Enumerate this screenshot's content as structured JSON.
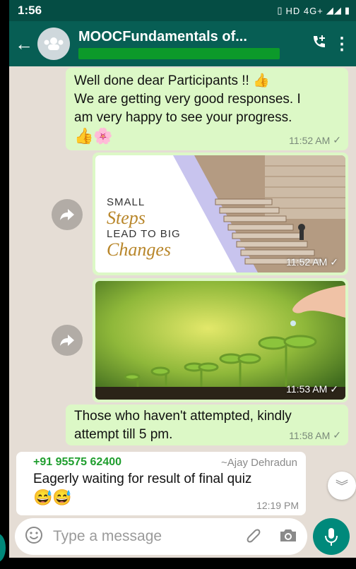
{
  "status_bar": {
    "time": "1:56",
    "indicators": "HD 4G+"
  },
  "header": {
    "title": "MOOCFundamentals of..."
  },
  "messages": [
    {
      "lines": [
        "Well done dear Participants !! 👍",
        "We are getting very good responses. I",
        "am very happy to see your progress."
      ],
      "emoji": "👍🌸",
      "time": "11:52 AM"
    },
    {
      "image": {
        "line1": "SMALL",
        "line2": "Steps",
        "line3": "LEAD TO BIG",
        "line4": "Changes"
      },
      "time": "11:52 AM"
    },
    {
      "image_alt": "seedlings-photo",
      "time": "11:53 AM"
    },
    {
      "lines": [
        "Those who haven't attempted, kindly",
        "attempt till 5 pm."
      ],
      "time": "11:58 AM"
    },
    {
      "sender": "+91 95575 62400",
      "sender_name": "~Ajay Dehradun",
      "text": "Eagerly waiting for result of final quiz",
      "emoji": "😅😅",
      "time": "12:19 PM"
    }
  ],
  "composer": {
    "placeholder": "Type a message"
  },
  "colors": {
    "header": "#075e54",
    "status": "#054d44",
    "outgoing": "#dcf8c6",
    "incoming": "#ffffff",
    "chat_bg": "#e5ddd5",
    "accent": "#00897b"
  }
}
